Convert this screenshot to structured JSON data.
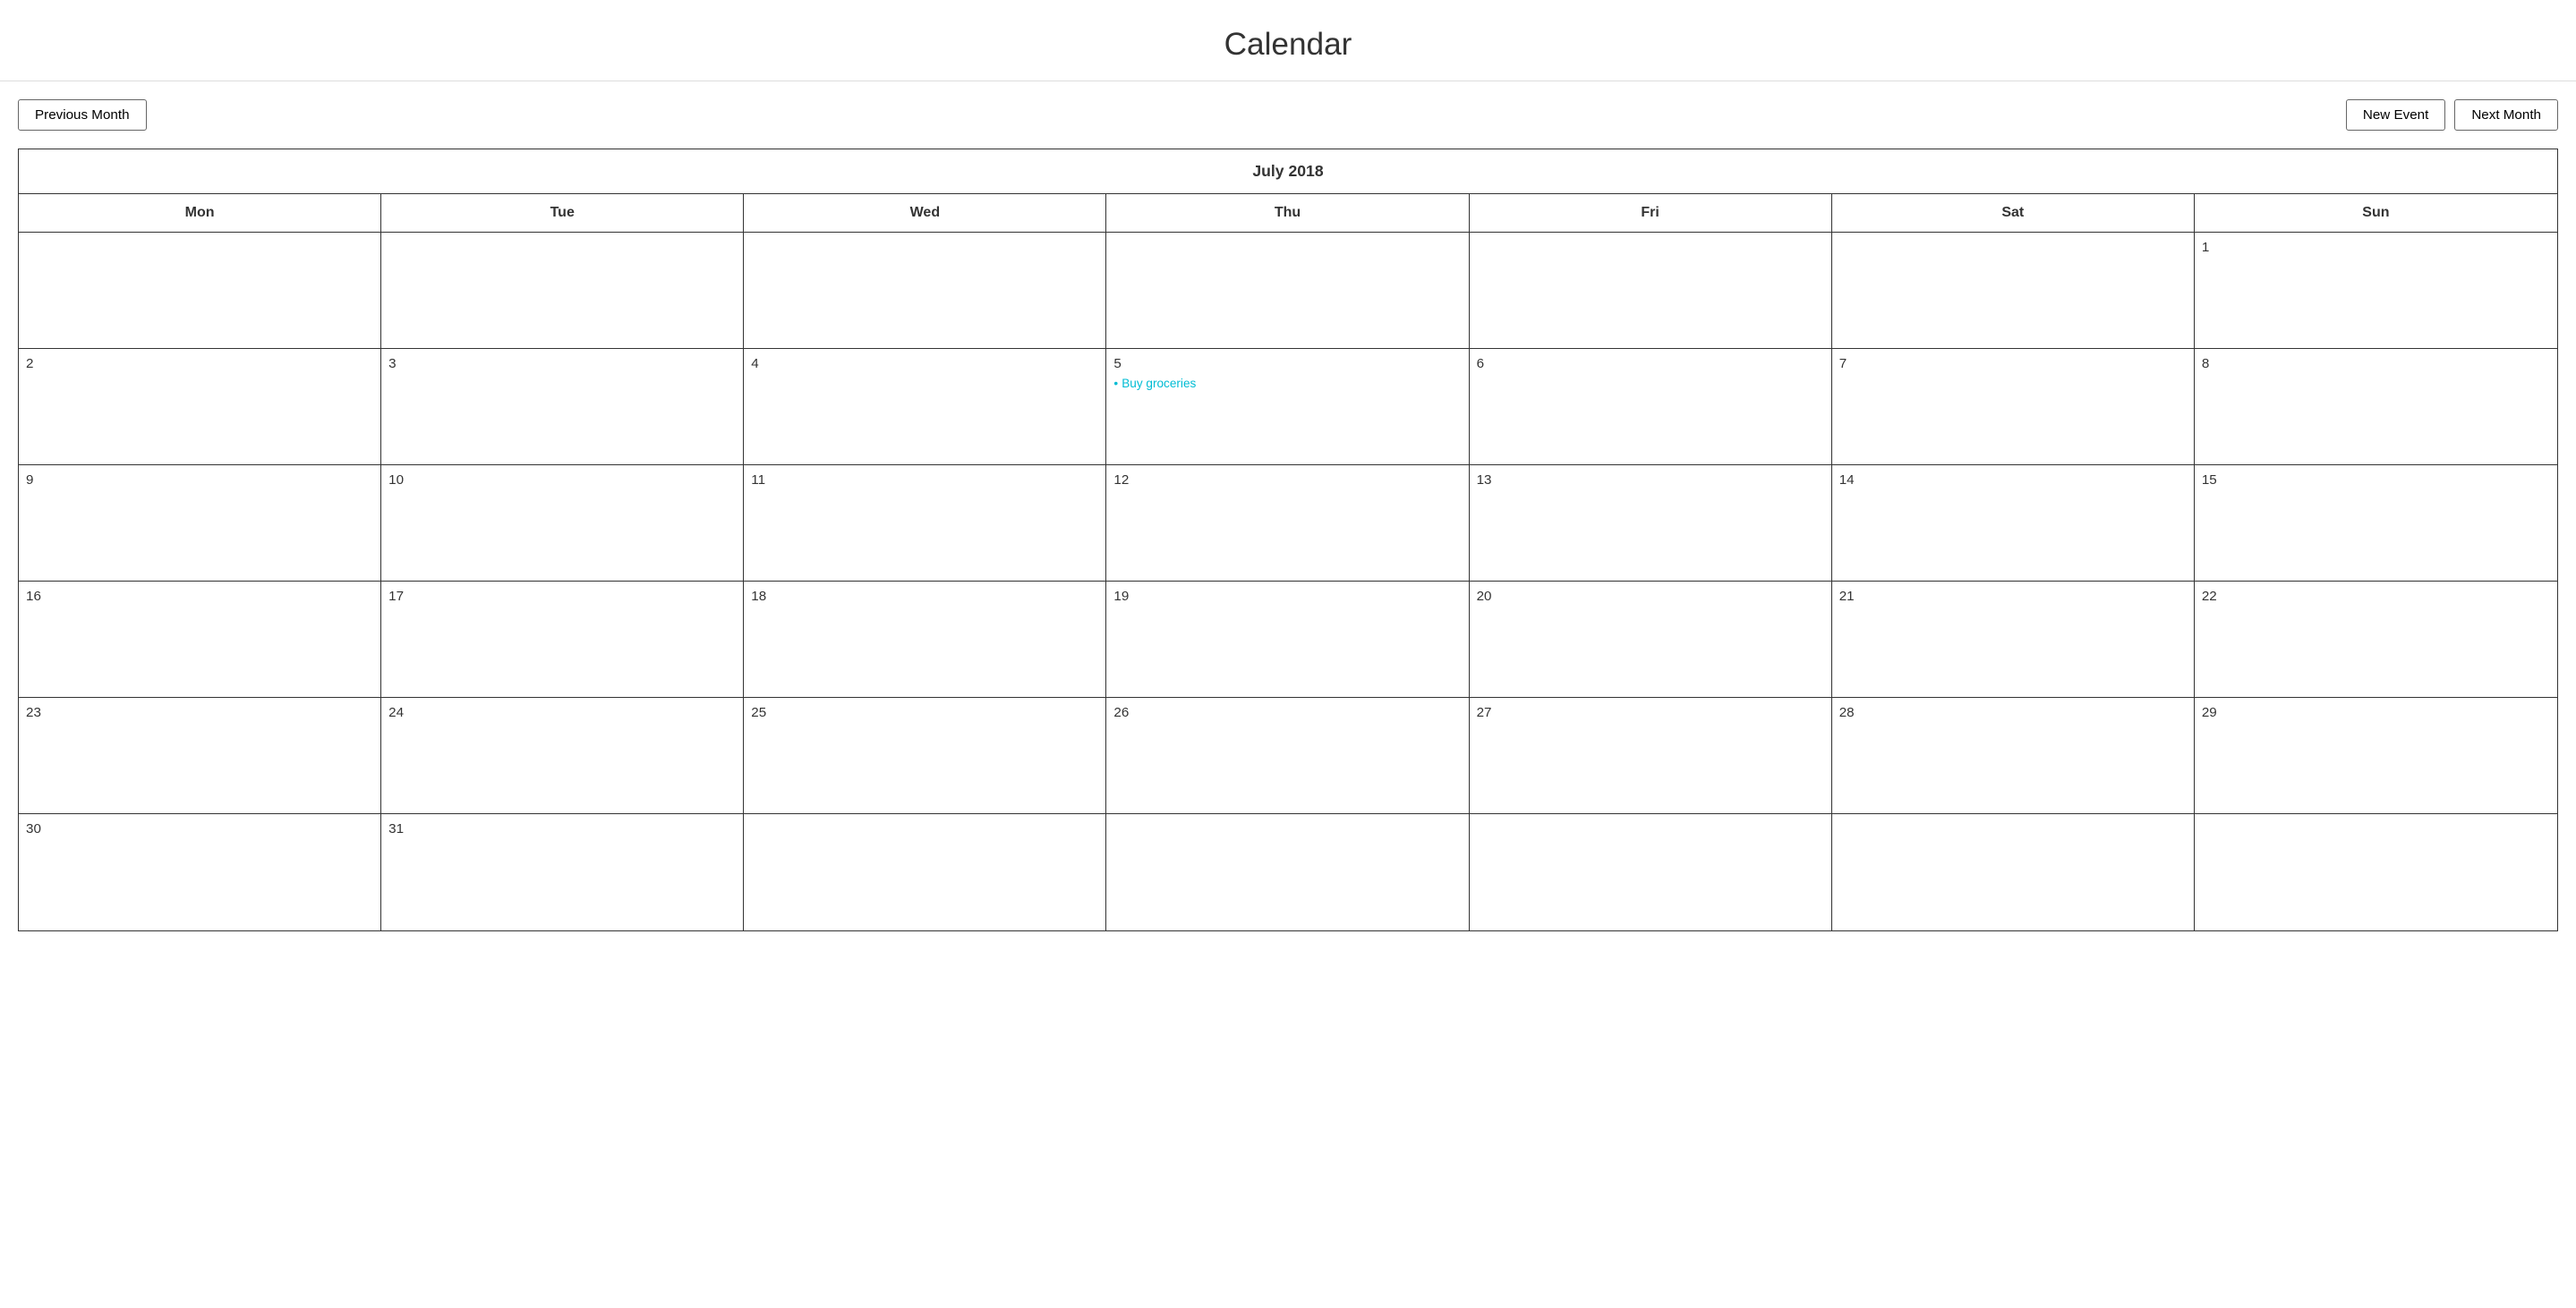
{
  "page": {
    "title": "Calendar"
  },
  "toolbar": {
    "prev_label": "Previous Month",
    "next_label": "Next Month",
    "new_event_label": "New Event"
  },
  "calendar": {
    "month_year": "July 2018",
    "day_names": [
      "Mon",
      "Tue",
      "Wed",
      "Thu",
      "Fri",
      "Sat",
      "Sun"
    ],
    "rows": [
      [
        {
          "day": "",
          "empty": true
        },
        {
          "day": "",
          "empty": true
        },
        {
          "day": "",
          "empty": true
        },
        {
          "day": "",
          "empty": true
        },
        {
          "day": "",
          "empty": true
        },
        {
          "day": "",
          "empty": true
        },
        {
          "day": "1",
          "events": []
        }
      ],
      [
        {
          "day": "2",
          "events": []
        },
        {
          "day": "3",
          "events": []
        },
        {
          "day": "4",
          "events": []
        },
        {
          "day": "5",
          "events": [
            {
              "label": "Buy groceries"
            }
          ]
        },
        {
          "day": "6",
          "events": []
        },
        {
          "day": "7",
          "events": []
        },
        {
          "day": "8",
          "events": []
        }
      ],
      [
        {
          "day": "9",
          "events": []
        },
        {
          "day": "10",
          "events": []
        },
        {
          "day": "11",
          "events": []
        },
        {
          "day": "12",
          "events": []
        },
        {
          "day": "13",
          "events": []
        },
        {
          "day": "14",
          "events": []
        },
        {
          "day": "15",
          "events": []
        }
      ],
      [
        {
          "day": "16",
          "events": []
        },
        {
          "day": "17",
          "events": []
        },
        {
          "day": "18",
          "events": []
        },
        {
          "day": "19",
          "events": []
        },
        {
          "day": "20",
          "events": []
        },
        {
          "day": "21",
          "events": []
        },
        {
          "day": "22",
          "events": []
        }
      ],
      [
        {
          "day": "23",
          "events": []
        },
        {
          "day": "24",
          "events": []
        },
        {
          "day": "25",
          "events": []
        },
        {
          "day": "26",
          "events": []
        },
        {
          "day": "27",
          "events": []
        },
        {
          "day": "28",
          "events": []
        },
        {
          "day": "29",
          "events": []
        }
      ],
      [
        {
          "day": "30",
          "events": []
        },
        {
          "day": "31",
          "events": []
        },
        {
          "day": "",
          "empty": true
        },
        {
          "day": "",
          "empty": true
        },
        {
          "day": "",
          "empty": true
        },
        {
          "day": "",
          "empty": true
        },
        {
          "day": "",
          "empty": true
        }
      ]
    ]
  }
}
